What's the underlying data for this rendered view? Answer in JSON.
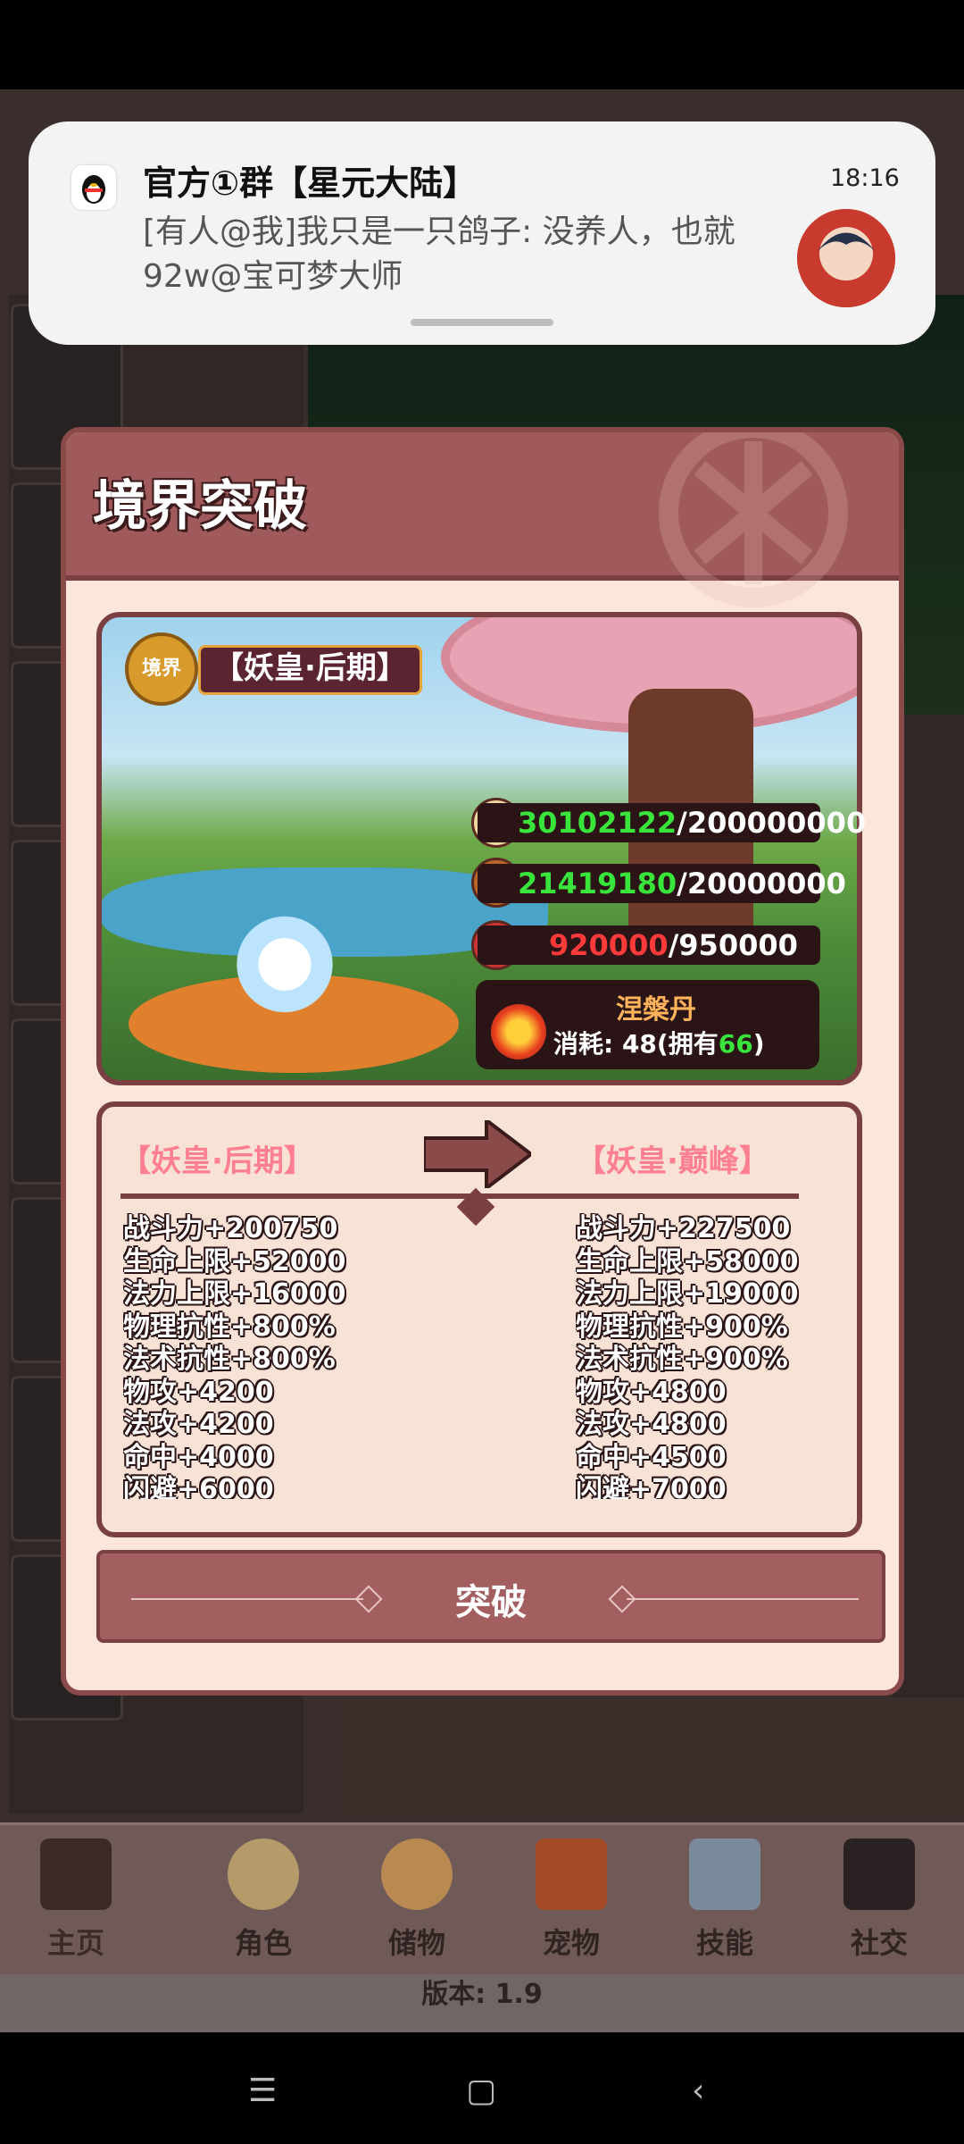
{
  "notification": {
    "app": "QQ",
    "title": "官方①群【星元大陆】",
    "time": "18:16",
    "body": "[有人@我]我只是一只鸽子: 没养人，也就92w@宝可梦大师"
  },
  "modal": {
    "title": "境界突破",
    "realm_badge": "境界",
    "current_realm_tag": "【妖皇·后期】",
    "stats": {
      "exp_icon": "經驗",
      "exp_current": "30102122",
      "exp_sep_total": "/200000000",
      "martial_icon": "武學",
      "martial_current": "21419180",
      "martial_sep_total": "/20000000",
      "power_icon": "戰力",
      "power_current": "920000",
      "power_sep_total": "/950000"
    },
    "pill": {
      "name": "涅槃丹",
      "cost_prefix": "消耗: 48(拥有",
      "owned": "66",
      "cost_suffix": ")"
    },
    "compare": {
      "from": "【妖皇·后期】",
      "to": "【妖皇·巅峰】",
      "from_stats": [
        "战斗力+200750",
        "生命上限+52000",
        "法力上限+16000",
        "物理抗性+800%",
        "法术抗性+800%",
        "物攻+4200",
        "法攻+4200",
        "命中+4000",
        "闪避+6000"
      ],
      "to_stats": [
        "战斗力+227500",
        "生命上限+58000",
        "法力上限+19000",
        "物理抗性+900%",
        "法术抗性+900%",
        "物攻+4800",
        "法攻+4800",
        "命中+4500",
        "闪避+7000"
      ]
    },
    "button_label": "突破"
  },
  "bottom_nav": {
    "items": [
      {
        "label": "主页"
      },
      {
        "label": "角色"
      },
      {
        "label": "储物"
      },
      {
        "label": "宠物"
      },
      {
        "label": "技能"
      },
      {
        "label": "社交"
      }
    ],
    "version": "版本: 1.9"
  },
  "colors": {
    "modal_header": "#a05a5c",
    "modal_border": "#8a4a4a",
    "accent_green": "#39e43b",
    "accent_red": "#ff3a3a",
    "realm_pink": "#ff7f92"
  }
}
